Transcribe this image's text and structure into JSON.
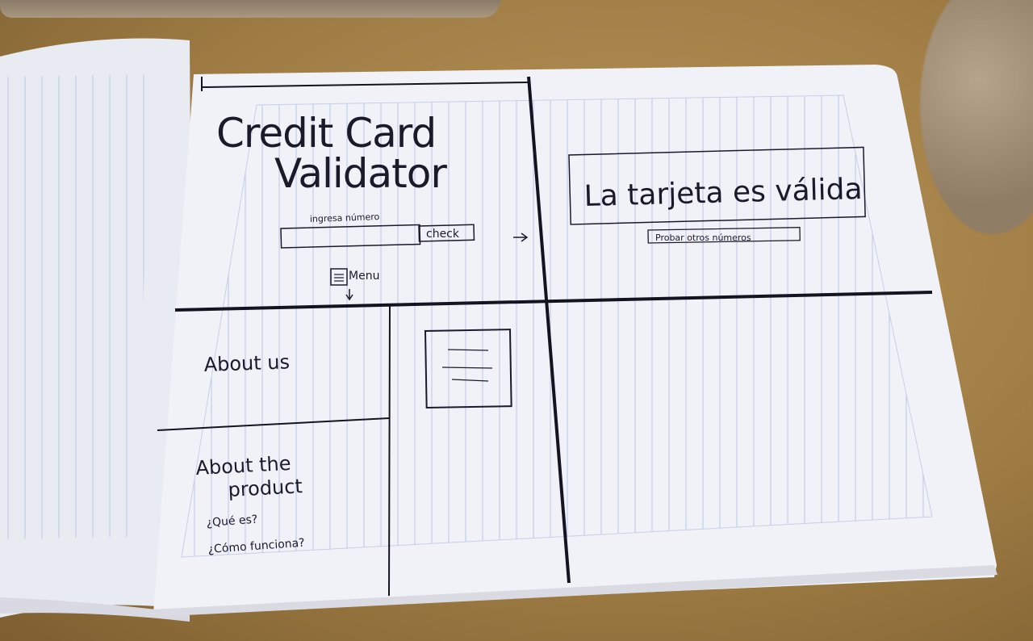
{
  "sketch": {
    "title_line1": "Credit Card",
    "title_line2": "Validator",
    "input_label": "ingresa número",
    "check_button": "check",
    "menu_label": "Menu",
    "result_text": "La tarjeta es válida",
    "retry_button": "Probar otros números",
    "about_us": "About us",
    "about_product_line1": "About the",
    "about_product_line2": "product",
    "faq_what": "¿Qué es?",
    "faq_how": "¿Cómo funciona?"
  }
}
